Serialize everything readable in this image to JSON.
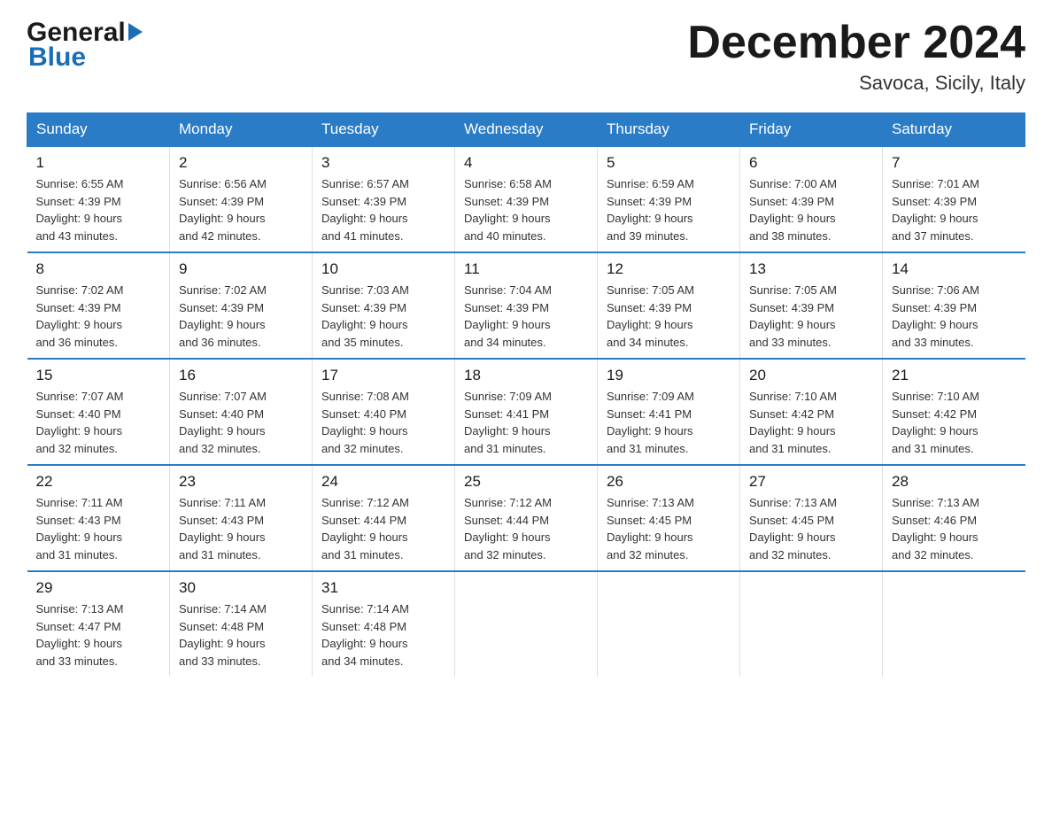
{
  "header": {
    "logo_text_general": "General",
    "logo_text_blue": "Blue",
    "month_title": "December 2024",
    "location": "Savoca, Sicily, Italy"
  },
  "days_of_week": [
    "Sunday",
    "Monday",
    "Tuesday",
    "Wednesday",
    "Thursday",
    "Friday",
    "Saturday"
  ],
  "weeks": [
    [
      {
        "day": "1",
        "sunrise": "6:55 AM",
        "sunset": "4:39 PM",
        "daylight": "9 hours and 43 minutes."
      },
      {
        "day": "2",
        "sunrise": "6:56 AM",
        "sunset": "4:39 PM",
        "daylight": "9 hours and 42 minutes."
      },
      {
        "day": "3",
        "sunrise": "6:57 AM",
        "sunset": "4:39 PM",
        "daylight": "9 hours and 41 minutes."
      },
      {
        "day": "4",
        "sunrise": "6:58 AM",
        "sunset": "4:39 PM",
        "daylight": "9 hours and 40 minutes."
      },
      {
        "day": "5",
        "sunrise": "6:59 AM",
        "sunset": "4:39 PM",
        "daylight": "9 hours and 39 minutes."
      },
      {
        "day": "6",
        "sunrise": "7:00 AM",
        "sunset": "4:39 PM",
        "daylight": "9 hours and 38 minutes."
      },
      {
        "day": "7",
        "sunrise": "7:01 AM",
        "sunset": "4:39 PM",
        "daylight": "9 hours and 37 minutes."
      }
    ],
    [
      {
        "day": "8",
        "sunrise": "7:02 AM",
        "sunset": "4:39 PM",
        "daylight": "9 hours and 36 minutes."
      },
      {
        "day": "9",
        "sunrise": "7:02 AM",
        "sunset": "4:39 PM",
        "daylight": "9 hours and 36 minutes."
      },
      {
        "day": "10",
        "sunrise": "7:03 AM",
        "sunset": "4:39 PM",
        "daylight": "9 hours and 35 minutes."
      },
      {
        "day": "11",
        "sunrise": "7:04 AM",
        "sunset": "4:39 PM",
        "daylight": "9 hours and 34 minutes."
      },
      {
        "day": "12",
        "sunrise": "7:05 AM",
        "sunset": "4:39 PM",
        "daylight": "9 hours and 34 minutes."
      },
      {
        "day": "13",
        "sunrise": "7:05 AM",
        "sunset": "4:39 PM",
        "daylight": "9 hours and 33 minutes."
      },
      {
        "day": "14",
        "sunrise": "7:06 AM",
        "sunset": "4:39 PM",
        "daylight": "9 hours and 33 minutes."
      }
    ],
    [
      {
        "day": "15",
        "sunrise": "7:07 AM",
        "sunset": "4:40 PM",
        "daylight": "9 hours and 32 minutes."
      },
      {
        "day": "16",
        "sunrise": "7:07 AM",
        "sunset": "4:40 PM",
        "daylight": "9 hours and 32 minutes."
      },
      {
        "day": "17",
        "sunrise": "7:08 AM",
        "sunset": "4:40 PM",
        "daylight": "9 hours and 32 minutes."
      },
      {
        "day": "18",
        "sunrise": "7:09 AM",
        "sunset": "4:41 PM",
        "daylight": "9 hours and 31 minutes."
      },
      {
        "day": "19",
        "sunrise": "7:09 AM",
        "sunset": "4:41 PM",
        "daylight": "9 hours and 31 minutes."
      },
      {
        "day": "20",
        "sunrise": "7:10 AM",
        "sunset": "4:42 PM",
        "daylight": "9 hours and 31 minutes."
      },
      {
        "day": "21",
        "sunrise": "7:10 AM",
        "sunset": "4:42 PM",
        "daylight": "9 hours and 31 minutes."
      }
    ],
    [
      {
        "day": "22",
        "sunrise": "7:11 AM",
        "sunset": "4:43 PM",
        "daylight": "9 hours and 31 minutes."
      },
      {
        "day": "23",
        "sunrise": "7:11 AM",
        "sunset": "4:43 PM",
        "daylight": "9 hours and 31 minutes."
      },
      {
        "day": "24",
        "sunrise": "7:12 AM",
        "sunset": "4:44 PM",
        "daylight": "9 hours and 31 minutes."
      },
      {
        "day": "25",
        "sunrise": "7:12 AM",
        "sunset": "4:44 PM",
        "daylight": "9 hours and 32 minutes."
      },
      {
        "day": "26",
        "sunrise": "7:13 AM",
        "sunset": "4:45 PM",
        "daylight": "9 hours and 32 minutes."
      },
      {
        "day": "27",
        "sunrise": "7:13 AM",
        "sunset": "4:45 PM",
        "daylight": "9 hours and 32 minutes."
      },
      {
        "day": "28",
        "sunrise": "7:13 AM",
        "sunset": "4:46 PM",
        "daylight": "9 hours and 32 minutes."
      }
    ],
    [
      {
        "day": "29",
        "sunrise": "7:13 AM",
        "sunset": "4:47 PM",
        "daylight": "9 hours and 33 minutes."
      },
      {
        "day": "30",
        "sunrise": "7:14 AM",
        "sunset": "4:48 PM",
        "daylight": "9 hours and 33 minutes."
      },
      {
        "day": "31",
        "sunrise": "7:14 AM",
        "sunset": "4:48 PM",
        "daylight": "9 hours and 34 minutes."
      },
      null,
      null,
      null,
      null
    ]
  ],
  "labels": {
    "sunrise": "Sunrise:",
    "sunset": "Sunset:",
    "daylight": "Daylight:"
  }
}
